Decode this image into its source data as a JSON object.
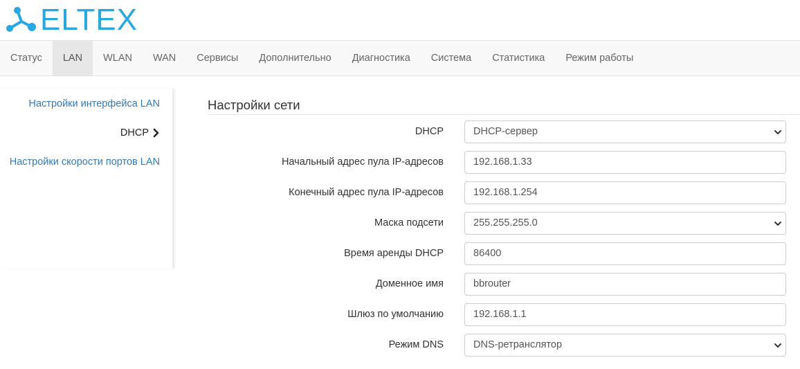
{
  "brand": {
    "logo_text": "ELTEX",
    "color": "#29a8e0"
  },
  "topnav": {
    "tabs": [
      {
        "label": "Статус",
        "active": false
      },
      {
        "label": "LAN",
        "active": true
      },
      {
        "label": "WLAN",
        "active": false
      },
      {
        "label": "WAN",
        "active": false
      },
      {
        "label": "Сервисы",
        "active": false
      },
      {
        "label": "Дополнительно",
        "active": false
      },
      {
        "label": "Диагностика",
        "active": false
      },
      {
        "label": "Система",
        "active": false
      },
      {
        "label": "Статистика",
        "active": false
      },
      {
        "label": "Режим работы",
        "active": false
      }
    ]
  },
  "sidebar": {
    "items": [
      {
        "label": "Настройки интерфейса LAN",
        "active": false
      },
      {
        "label": "DHCP",
        "active": true,
        "icon": "chevron-right-icon"
      },
      {
        "label": "Настройки скорости портов LAN",
        "active": false
      }
    ]
  },
  "main": {
    "title": "Настройки сети",
    "fields": [
      {
        "label": "DHCP",
        "value": "DHCP-сервер",
        "type": "select"
      },
      {
        "label": "Начальный адрес пула IP-адресов",
        "value": "192.168.1.33",
        "type": "text"
      },
      {
        "label": "Конечный адрес пула IP-адресов",
        "value": "192.168.1.254",
        "type": "text"
      },
      {
        "label": "Маска подсети",
        "value": "255.255.255.0",
        "type": "select"
      },
      {
        "label": "Время аренды DHCP",
        "value": "86400",
        "type": "text"
      },
      {
        "label": "Доменное имя",
        "value": "bbrouter",
        "type": "text"
      },
      {
        "label": "Шлюз по умолчанию",
        "value": "192.168.1.1",
        "type": "text"
      },
      {
        "label": "Режим DNS",
        "value": "DNS-ретранслятор",
        "type": "select"
      }
    ]
  },
  "colors": {
    "link": "#337ab7",
    "active_tab_bg": "#e7e7e7",
    "nav_bg": "#f8f8f8"
  }
}
